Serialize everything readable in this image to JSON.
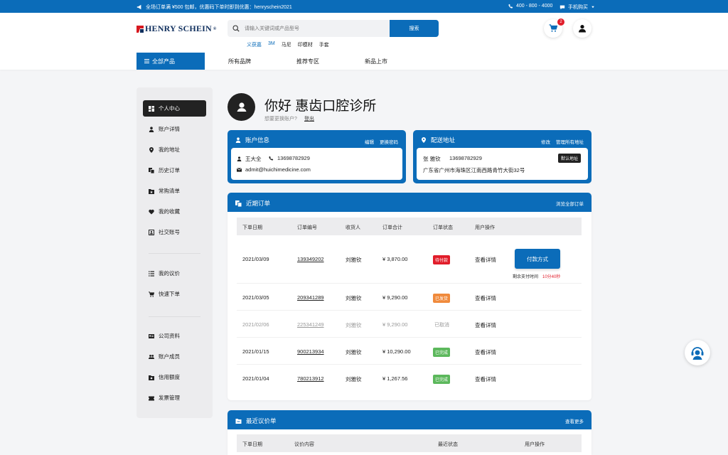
{
  "topbar": {
    "promo": "全场订单满 ¥500 包邮，优惠码下单时即到优惠：henryschein2021",
    "phone": "400 - 800 - 4000",
    "mobile": "手机购买"
  },
  "brand": {
    "name": "HENRY SCHEIN",
    "mark": "®"
  },
  "search": {
    "placeholder": "请输入关键词或产品型号",
    "button": "搜索"
  },
  "hotkeys": [
    "义获嘉",
    "3M",
    "马尼",
    "印模材",
    "手套"
  ],
  "cart": {
    "count": "2"
  },
  "nav": {
    "all_products": "全部产品",
    "links": [
      "所有品牌",
      "推荐专区",
      "新品上市"
    ]
  },
  "sidebar": {
    "items": [
      {
        "label": "个人中心",
        "icon": "dashboard-icon"
      },
      {
        "label": "账户详情",
        "icon": "person-icon"
      },
      {
        "label": "我的地址",
        "icon": "location-pin-icon"
      },
      {
        "label": "历史订单",
        "icon": "orders-icon"
      },
      {
        "label": "常购清单",
        "icon": "folder-star-icon"
      },
      {
        "label": "我的收藏",
        "icon": "heart-icon"
      },
      {
        "label": "社交账号",
        "icon": "social-account-icon"
      },
      {
        "label": "我的议价",
        "icon": "list-icon"
      },
      {
        "label": "快速下单",
        "icon": "quick-cart-icon"
      },
      {
        "label": "公司资料",
        "icon": "company-card-icon"
      },
      {
        "label": "账户成员",
        "icon": "members-icon"
      },
      {
        "label": "信用额度",
        "icon": "credit-folder-icon"
      },
      {
        "label": "发票管理",
        "icon": "invoice-icon"
      }
    ]
  },
  "greeting": {
    "title": "你好 惠齿口腔诊所",
    "switch_prompt": "想要更换账户?",
    "logout": "登出"
  },
  "account": {
    "title": "账户信息",
    "edit": "编辑",
    "change_password": "更换密码",
    "name": "王大全",
    "phone": "13698782929",
    "email": "admit@huichimedicine.com"
  },
  "shipping": {
    "title": "配送地址",
    "edit": "修改",
    "manage": "管理所有地址",
    "name": "张 雅钦",
    "phone": "13698782929",
    "default_badge": "默认地址",
    "address": "广东省广州市海珠区江南西路青竹大街32号"
  },
  "orders": {
    "title": "近期订单",
    "view_all": "浏览全部订单",
    "headers": [
      "下单日期",
      "订单编号",
      "收货人",
      "订单合计",
      "订单状态",
      "用户操作"
    ],
    "detail_label": "查看详情",
    "pay_button": "付款方式",
    "pay_countdown_label": "剩余支付时间",
    "pay_countdown": "10分40秒",
    "rows": [
      {
        "date": "2021/03/09",
        "number": "139349202",
        "receiver": "刘雅钦",
        "total": "¥ 3,870.00",
        "status": "待付款",
        "status_color": "#e11d2a"
      },
      {
        "date": "2021/03/05",
        "number": "209341289",
        "receiver": "刘雅钦",
        "total": "¥ 9,290.00",
        "status": "已发货",
        "status_color": "#f08a3c"
      },
      {
        "date": "2021/02/06",
        "number": "225341249",
        "receiver": "刘雅钦",
        "total": "¥ 9,290.00",
        "status": "已取消",
        "status_color": ""
      },
      {
        "date": "2021/01/15",
        "number": "900213934",
        "receiver": "刘雅钦",
        "total": "¥ 10,290.00",
        "status": "已完成",
        "status_color": "#5cb85c"
      },
      {
        "date": "2021/01/04",
        "number": "780213912",
        "receiver": "刘雅钦",
        "total": "¥ 1,267.56",
        "status": "已完成",
        "status_color": "#5cb85c"
      }
    ]
  },
  "quotes": {
    "title": "最近议价单",
    "view_more": "查看更多",
    "headers": [
      "下单日期",
      "议价内容",
      "最近状态",
      "用户操作"
    ]
  }
}
